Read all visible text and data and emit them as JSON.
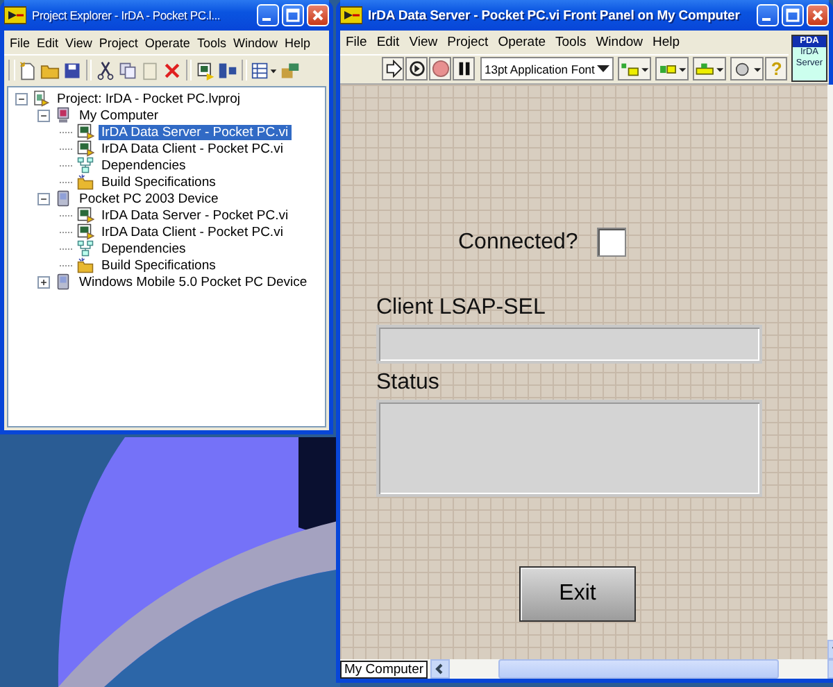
{
  "explorer": {
    "title": "Project Explorer - IrDA - Pocket PC.l...",
    "menu": [
      "File",
      "Edit",
      "View",
      "Project",
      "Operate",
      "Tools",
      "Window",
      "Help"
    ],
    "tree": [
      {
        "label": "Project: IrDA - Pocket PC.lvproj",
        "kind": "project",
        "expanded": true,
        "selected": false,
        "children": [
          {
            "label": "My Computer",
            "kind": "computer",
            "expanded": true,
            "selected": false,
            "children": [
              {
                "label": "IrDA Data Server - Pocket PC.vi",
                "kind": "vi",
                "selected": true
              },
              {
                "label": "IrDA Data Client - Pocket PC.vi",
                "kind": "vi",
                "selected": false
              },
              {
                "label": "Dependencies",
                "kind": "dependencies",
                "selected": false
              },
              {
                "label": "Build Specifications",
                "kind": "build",
                "selected": false
              }
            ]
          },
          {
            "label": "Pocket PC 2003 Device",
            "kind": "device",
            "expanded": true,
            "selected": false,
            "children": [
              {
                "label": "IrDA Data Server - Pocket PC.vi",
                "kind": "vi",
                "selected": false
              },
              {
                "label": "IrDA Data Client - Pocket PC.vi",
                "kind": "vi",
                "selected": false
              },
              {
                "label": "Dependencies",
                "kind": "dependencies",
                "selected": false
              },
              {
                "label": "Build Specifications",
                "kind": "build",
                "selected": false
              }
            ]
          },
          {
            "label": "Windows Mobile 5.0 Pocket PC Device",
            "kind": "device",
            "expanded": false,
            "selected": false
          }
        ]
      }
    ]
  },
  "front_panel": {
    "title": "IrDA Data Server - Pocket PC.vi Front Panel on My Computer",
    "menu": [
      "File",
      "Edit",
      "View",
      "Project",
      "Operate",
      "Tools",
      "Window",
      "Help"
    ],
    "font_selector": "13pt Application Font",
    "help_button": "?",
    "vi_icon": {
      "header": "PDA",
      "lines": [
        "IrDA",
        "Server"
      ]
    },
    "connected": {
      "label": "Connected?",
      "checked": false
    },
    "client_lsap_sel": {
      "label": "Client LSAP-SEL"
    },
    "status": {
      "label": "Status"
    },
    "exit_button": "Exit",
    "context": "My Computer"
  }
}
